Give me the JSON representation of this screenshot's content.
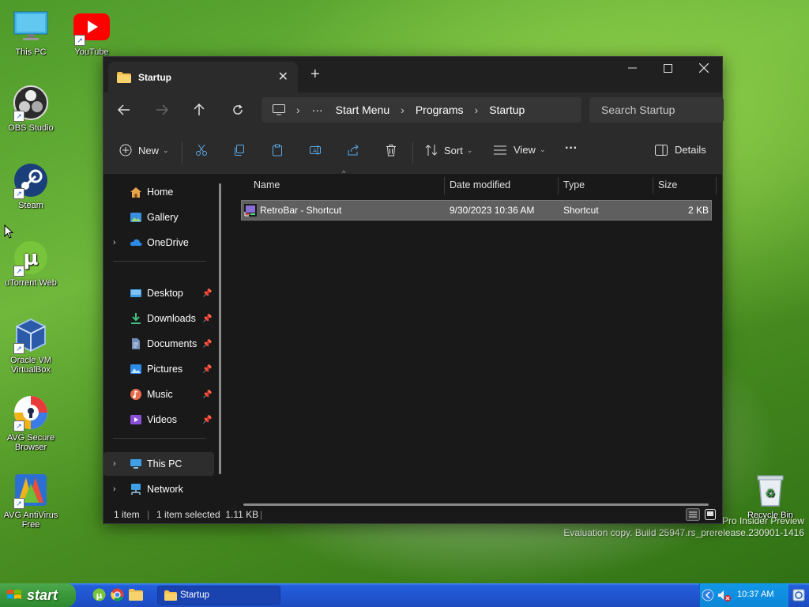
{
  "desktop": {
    "icons": [
      {
        "label": "This PC",
        "icon": "monitor-icon"
      },
      {
        "label": "YouTube",
        "icon": "youtube-icon"
      },
      {
        "label": "OBS Studio",
        "icon": "obs-icon"
      },
      {
        "label": "Steam",
        "icon": "steam-icon"
      },
      {
        "label": "uTorrent Web",
        "icon": "utorrent-icon"
      },
      {
        "label": "Oracle VM VirtualBox",
        "icon": "virtualbox-icon"
      },
      {
        "label": "AVG Secure Browser",
        "icon": "avg-browser-icon"
      },
      {
        "label": "AVG AntiVirus Free",
        "icon": "avg-antivirus-icon"
      },
      {
        "label": "Recycle Bin",
        "icon": "recycle-bin-icon"
      }
    ],
    "watermark_line1": "Pro Insider Preview",
    "watermark_line2": "Evaluation copy. Build 25947.rs_prerelease.230901-1416"
  },
  "explorer": {
    "tab_title": "Startup",
    "new_tab": "+",
    "breadcrumb": [
      "Start Menu",
      "Programs",
      "Startup"
    ],
    "breadcrumb_ellipsis": "···",
    "search_placeholder": "Search Startup",
    "toolbar": {
      "new_label": "New",
      "sort_label": "Sort",
      "view_label": "View",
      "more_label": "···",
      "details_label": "Details"
    },
    "nav": {
      "home": "Home",
      "gallery": "Gallery",
      "onedrive": "OneDrive",
      "desktop": "Desktop",
      "downloads": "Downloads",
      "documents": "Documents",
      "pictures": "Pictures",
      "music": "Music",
      "videos": "Videos",
      "this_pc": "This PC",
      "network": "Network"
    },
    "columns": {
      "name": "Name",
      "date": "Date modified",
      "type": "Type",
      "size": "Size"
    },
    "files": [
      {
        "name": "RetroBar - Shortcut",
        "date": "9/30/2023 10:36 AM",
        "type": "Shortcut",
        "size": "2 KB"
      }
    ],
    "status": {
      "items": "1 item",
      "selected": "1 item selected  1.11 KB"
    }
  },
  "taskbar": {
    "start_label": "start",
    "task_label": "Startup",
    "clock": "10:37 AM"
  },
  "colors": {
    "accent": "#60cdff",
    "window_bg": "#191919",
    "taskbar": "#245edb",
    "start": "#3c9b3c"
  }
}
